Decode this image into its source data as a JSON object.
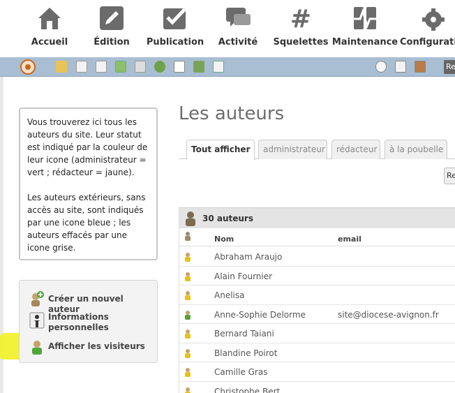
{
  "nav": {
    "items": [
      {
        "label": "Accueil",
        "icon": "home-icon"
      },
      {
        "label": "Édition",
        "icon": "pencil-icon"
      },
      {
        "label": "Publication",
        "icon": "checkbox-icon"
      },
      {
        "label": "Activité",
        "icon": "chat-icon"
      },
      {
        "label": "Squelettes",
        "icon": "hash-icon"
      },
      {
        "label": "Maintenance",
        "icon": "pulse-icon"
      },
      {
        "label": "Configuration",
        "icon": "gear-icon"
      }
    ]
  },
  "toolbar": {
    "right_label": "Re"
  },
  "sidebar": {
    "info_p1": "Vous trouverez ici tous les auteurs du site. Leur statut est indiqué par la couleur de leur icone (administrateur = vert ; rédacteur = jaune).",
    "info_p2": "Les auteurs extérieurs, sans accès au site, sont indiqués par une icone bleue ; les auteurs effacés par une icone grise.",
    "actions": [
      {
        "label": "Créer un nouvel auteur",
        "icon": "add-user-icon"
      },
      {
        "label": "Informations personnelles",
        "icon": "person-icon"
      },
      {
        "label": "Afficher les visiteurs",
        "icon": "visitor-icon"
      }
    ]
  },
  "main": {
    "title": "Les auteurs",
    "tabs": [
      {
        "label": "Tout afficher",
        "active": true
      },
      {
        "label": "administrateur",
        "active": false
      },
      {
        "label": "rédacteur",
        "active": false
      },
      {
        "label": "à la poubelle",
        "active": false
      }
    ],
    "side_button": "Re"
  },
  "table": {
    "count_label": "30 auteurs",
    "col_nom": "Nom",
    "col_email": "email",
    "rows": [
      {
        "name": "Abraham Araujo",
        "email": "",
        "status": "redacteur"
      },
      {
        "name": "Alain Fournier",
        "email": "",
        "status": "redacteur"
      },
      {
        "name": "Anelisa",
        "email": "",
        "status": "redacteur"
      },
      {
        "name": "Anne-Sophie Delorme",
        "email": "site@diocese-avignon.fr",
        "status": "administrateur"
      },
      {
        "name": "Bernard Taiani",
        "email": "",
        "status": "redacteur"
      },
      {
        "name": "Blandine Poirot",
        "email": "",
        "status": "redacteur"
      },
      {
        "name": "Camille Gras",
        "email": "",
        "status": "redacteur"
      },
      {
        "name": "Christophe Bert",
        "email": "",
        "status": "redacteur"
      }
    ]
  },
  "colors": {
    "redacteur": "#e8c21a",
    "administrateur": "#5aa03a",
    "highlight": "#f1f12a",
    "toolbar": "#a9bed2"
  }
}
